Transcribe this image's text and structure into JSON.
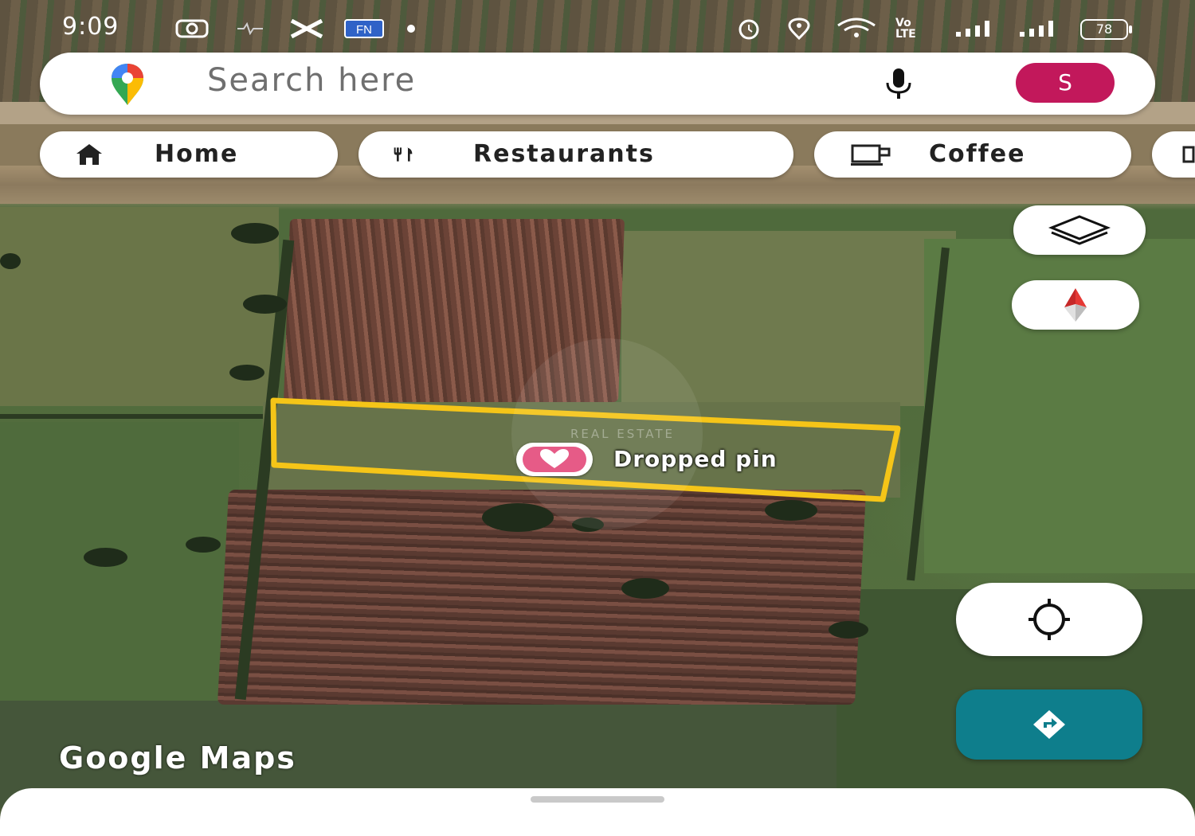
{
  "status_bar": {
    "time": "9:09",
    "battery": "78",
    "network_label": "LTE",
    "volte_label": "Vo"
  },
  "search": {
    "placeholder": "Search here",
    "avatar_letter": "S"
  },
  "chips": [
    {
      "label": "Home",
      "icon": "home-icon"
    },
    {
      "label": "Restaurants",
      "icon": "restaurant-icon"
    },
    {
      "label": "Coffee",
      "icon": "coffee-icon"
    }
  ],
  "map": {
    "pin_label": "Dropped pin",
    "watermark_text": "REAL ESTATE",
    "brand": "Google Maps"
  },
  "colors": {
    "avatar": "#c2185b",
    "directions": "#0e7e8c",
    "boundary": "#f5c518",
    "pin": "#e65b87"
  }
}
